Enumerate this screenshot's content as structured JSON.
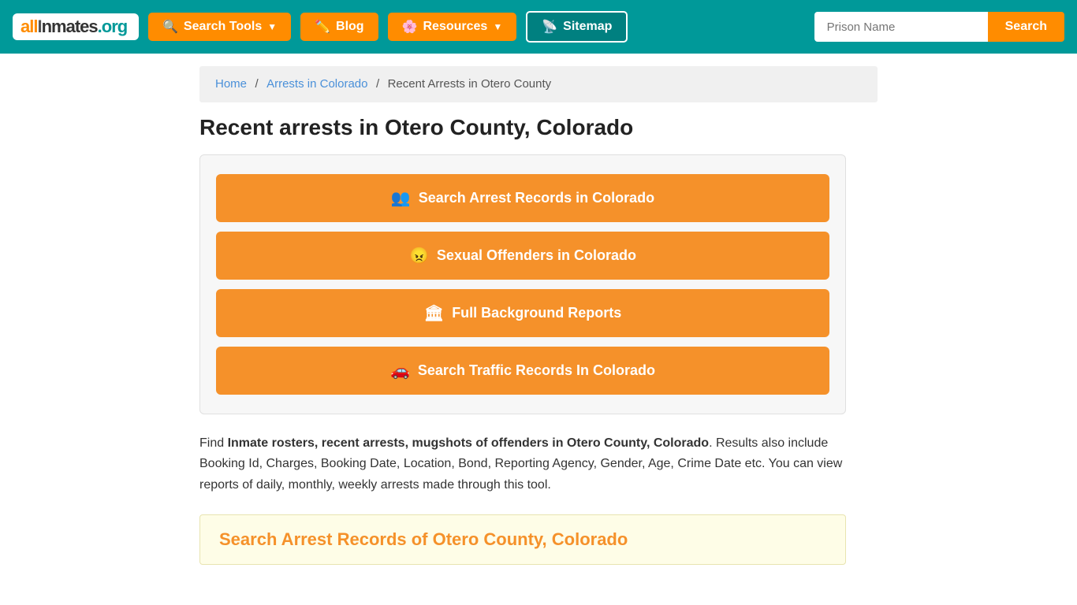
{
  "navbar": {
    "logo": {
      "part1": "all",
      "part2": "Inmates",
      "part3": ".org"
    },
    "buttons": [
      {
        "id": "search-tools",
        "label": "Search Tools",
        "icon": "🔍",
        "hasDropdown": true
      },
      {
        "id": "blog",
        "label": "Blog",
        "icon": "✏️",
        "hasDropdown": false
      },
      {
        "id": "resources",
        "label": "Resources",
        "icon": "🌸",
        "hasDropdown": true
      },
      {
        "id": "sitemap",
        "label": "Sitemap",
        "icon": "📡",
        "hasDropdown": false
      }
    ],
    "search": {
      "placeholder": "Prison Name",
      "button_label": "Search"
    }
  },
  "breadcrumb": {
    "items": [
      {
        "label": "Home",
        "href": "#"
      },
      {
        "label": "Arrests in Colorado",
        "href": "#"
      },
      {
        "label": "Recent Arrests in Otero County",
        "href": "#"
      }
    ]
  },
  "page": {
    "title": "Recent arrests in Otero County, Colorado",
    "action_buttons": [
      {
        "id": "arrest-records",
        "icon": "👥",
        "label": "Search Arrest Records in Colorado"
      },
      {
        "id": "sexual-offenders",
        "icon": "😠",
        "label": "Sexual Offenders in Colorado"
      },
      {
        "id": "background-reports",
        "icon": "🏛",
        "label": "Full Background Reports"
      },
      {
        "id": "traffic-records",
        "icon": "🚗",
        "label": "Search Traffic Records In Colorado"
      }
    ],
    "description_intro": "Find ",
    "description_bold": "Inmate rosters, recent arrests, mugshots of offenders in Otero County, Colorado",
    "description_rest": ". Results also include Booking Id, Charges, Booking Date, Location, Bond, Reporting Agency, Gender, Age, Crime Date etc. You can view reports of daily, monthly, weekly arrests made through this tool.",
    "section_heading": "Search Arrest Records of Otero County, Colorado"
  }
}
